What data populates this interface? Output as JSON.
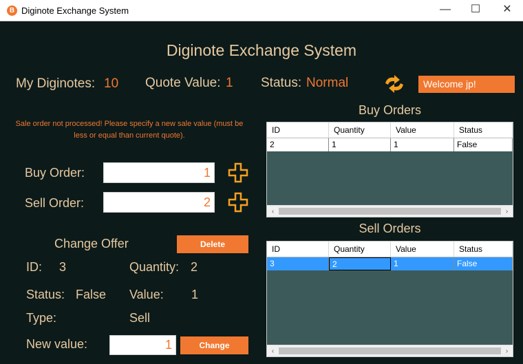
{
  "window": {
    "title": "Diginote Exchange System",
    "icon_letter": "B",
    "minimize": "—",
    "maximize": "☐",
    "close": "✕"
  },
  "header": {
    "title": "Diginote Exchange System"
  },
  "info": {
    "my_diginotes_label": "My Diginotes:",
    "my_diginotes_value": "10",
    "quote_label": "Quote Value:",
    "quote_value": "1",
    "status_label": "Status:",
    "status_value": "Normal",
    "welcome": "Welcome jp!"
  },
  "message": "Sale order not processed! Please specify a new sale value (must be less or equal than current quote).",
  "orders": {
    "buy_label": "Buy Order:",
    "buy_value": "1",
    "sell_label": "Sell Order:",
    "sell_value": "2"
  },
  "change_offer": {
    "title": "Change Offer",
    "delete_label": "Delete",
    "id_label": "ID:",
    "id_value": "3",
    "quantity_label": "Quantity:",
    "quantity_value": "2",
    "status_label": "Status:",
    "status_value": "False",
    "value_label": "Value:",
    "value_value": "1",
    "type_label": "Type:",
    "type_value": "Sell",
    "new_value_label": "New value:",
    "new_value": "1",
    "change_label": "Change"
  },
  "buy_grid": {
    "title": "Buy Orders",
    "columns": [
      "ID",
      "Quantity",
      "Value",
      "Status"
    ],
    "rows": [
      [
        "2",
        "1",
        "1",
        "False"
      ]
    ]
  },
  "sell_grid": {
    "title": "Sell Orders",
    "columns": [
      "ID",
      "Quantity",
      "Value",
      "Status"
    ],
    "rows": [
      [
        "3",
        "2",
        "1",
        "False"
      ]
    ]
  },
  "colors": {
    "accent": "#f07830",
    "background": "#0c1a1a",
    "label": "#e7c9a0",
    "grid_bg": "#3d5a5a",
    "selection": "#3399ff"
  },
  "icons": {
    "refresh": "refresh-arrows-icon",
    "add": "plus-icon"
  }
}
